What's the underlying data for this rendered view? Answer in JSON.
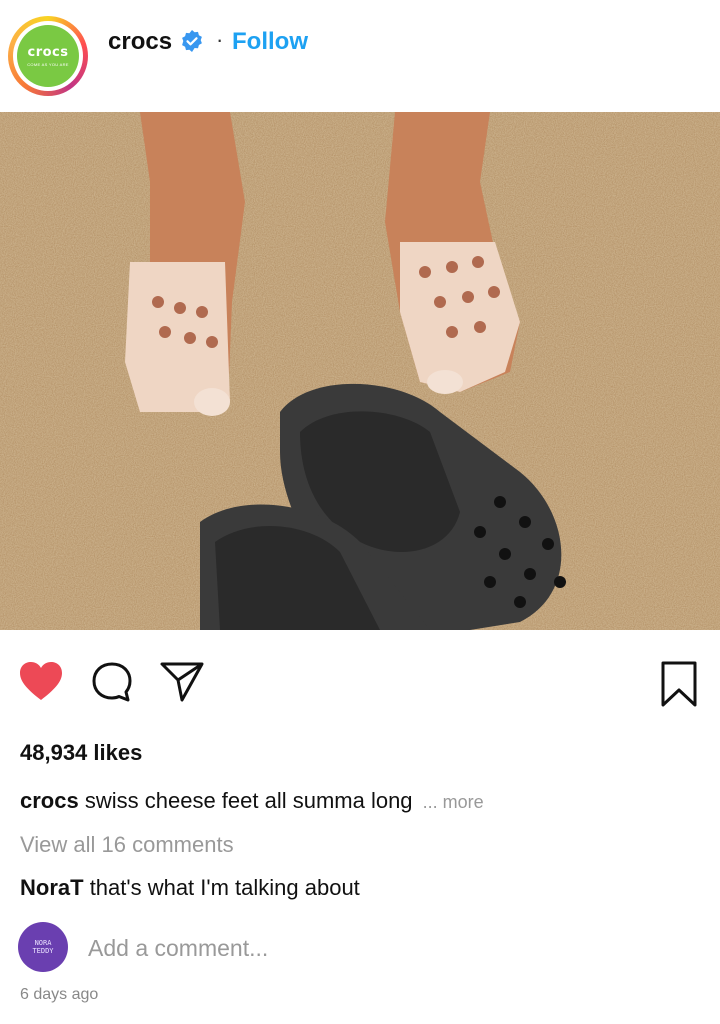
{
  "post": {
    "username": "crocs",
    "follow_label": "Follow",
    "separator": "·",
    "avatar_brand": "crocs",
    "avatar_tagline": "COME AS YOU ARE",
    "likes": "48,934 likes",
    "caption_user": "crocs",
    "caption_text": "swiss cheese feet all summa long",
    "caption_more": "... more",
    "view_comments": "View all 16 comments",
    "comment_user": "NoraT",
    "comment_text": "that's what I'm talking about",
    "comment_avatar_line1": "NORA",
    "comment_avatar_line2": "TEDDY",
    "add_comment_placeholder": "Add a comment...",
    "timestamp": "6 days ago"
  },
  "icons": {
    "like": "heart-icon",
    "comment": "comment-icon",
    "share": "share-icon",
    "save": "bookmark-icon",
    "verified": "verified-badge-icon"
  },
  "colors": {
    "heart": "#ed4956",
    "follow": "#1da1f2",
    "avatar_bg": "#7ac943",
    "commenter_avatar_bg": "#6a3fb0"
  }
}
